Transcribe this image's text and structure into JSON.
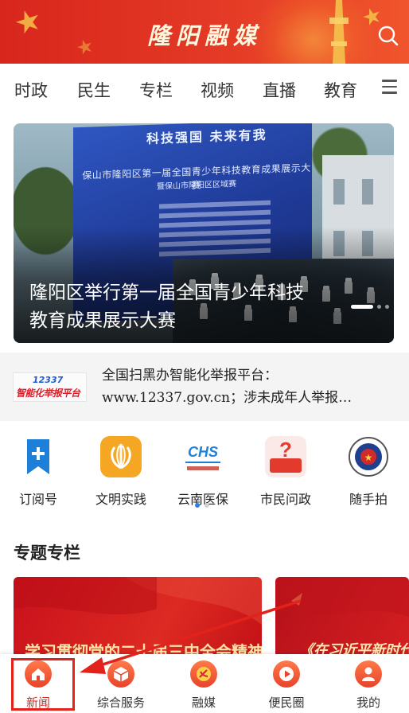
{
  "header": {
    "title": "隆阳融媒",
    "search_icon": "search-icon"
  },
  "nav": {
    "tabs": [
      "时政",
      "民生",
      "专栏",
      "视频",
      "直播",
      "教育"
    ],
    "menu_icon": "menu-icon"
  },
  "banner": {
    "board_slogan": "科技强国 未来有我",
    "board_line1": "保山市隆阳区第一届全国青少年科技教育成果展示大赛",
    "board_line2": "暨保山市隆阳区区域赛",
    "caption": "隆阳区举行第一届全国青少年科技教育成果展示大赛"
  },
  "notice": {
    "logo_number": "12337",
    "logo_text": "智能化举报平台",
    "line1": "全国扫黑办智能化举报平台：",
    "line2": "www.12337.gov.cn；涉未成年人举报…"
  },
  "quick_links": [
    {
      "label": "订阅号",
      "icon": "bookmark-plus-icon"
    },
    {
      "label": "文明实践",
      "icon": "civilization-icon"
    },
    {
      "label": "云南医保",
      "icon": "chs-medical-insurance-icon"
    },
    {
      "label": "市民问政",
      "icon": "question-icon"
    },
    {
      "label": "随手拍",
      "icon": "police-emblem-icon"
    }
  ],
  "special": {
    "title": "专题专栏",
    "cards": [
      {
        "text": "学习贯彻党的二十届三中全会精神"
      },
      {
        "text": "《在习近平新时代中"
      }
    ]
  },
  "tabbar": {
    "items": [
      {
        "label": "新闻",
        "icon": "home-icon",
        "active": true
      },
      {
        "label": "综合服务",
        "icon": "box-icon",
        "active": false
      },
      {
        "label": "融媒",
        "icon": "party-emblem-icon",
        "active": false
      },
      {
        "label": "便民圈",
        "icon": "play-icon",
        "active": false
      },
      {
        "label": "我的",
        "icon": "user-icon",
        "active": false
      }
    ]
  },
  "colors": {
    "brand_red": "#e43a26",
    "active_tab": "#d32a22",
    "annotation_red": "#e3221b"
  }
}
